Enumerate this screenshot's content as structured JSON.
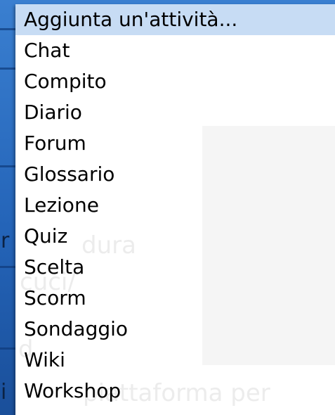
{
  "background": {
    "color": "#2464b8",
    "edge_glyphs": [
      "r",
      "i"
    ],
    "watermark": {
      "line1": "dura",
      "line2": "cuci/",
      "line3": "d",
      "line4": "piattaforma per"
    }
  },
  "dropdown": {
    "selected_index": 0,
    "selected_color": "#c7dcf4",
    "items": [
      {
        "label": "Aggiunta un'attività..."
      },
      {
        "label": "Chat"
      },
      {
        "label": "Compito"
      },
      {
        "label": "Diario"
      },
      {
        "label": "Forum"
      },
      {
        "label": "Glossario"
      },
      {
        "label": "Lezione"
      },
      {
        "label": "Quiz"
      },
      {
        "label": "Scelta"
      },
      {
        "label": "Scorm"
      },
      {
        "label": "Sondaggio"
      },
      {
        "label": "Wiki"
      },
      {
        "label": "Workshop"
      }
    ]
  }
}
